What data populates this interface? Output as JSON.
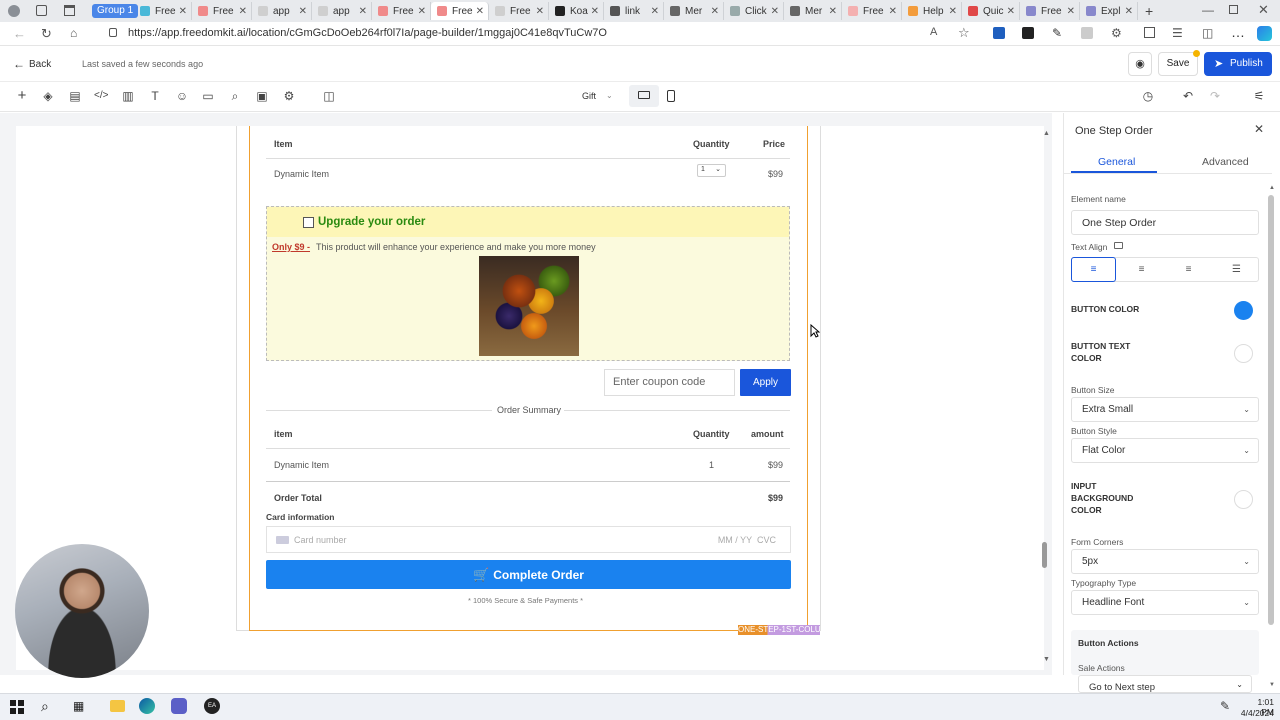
{
  "browser": {
    "group_label": "Group 1",
    "tabs": [
      "Free",
      "Free",
      "app",
      "app",
      "Free",
      "Free",
      "Free",
      "Koa",
      "link",
      "Mer",
      "Click",
      "Mer",
      "Free",
      "Help",
      "Quic",
      "Free",
      "Expl"
    ],
    "url": "https://app.freedomkit.ai/location/cGmGcDoOeb264rf0l7Ia/page-builder/1mggaj0C41e8qvTuCw7O"
  },
  "header": {
    "back_label": "Back",
    "saved_status": "Last saved a few seconds ago",
    "save_label": "Save",
    "publish_label": "Publish"
  },
  "toolbar": {
    "gift_label": "Gift"
  },
  "order": {
    "headers": {
      "item": "Item",
      "quantity": "Quantity",
      "price": "Price"
    },
    "item_name": "Dynamic Item",
    "item_qty": "1",
    "item_price": "$99",
    "upsell": {
      "title": "Upgrade your order",
      "offer_price": "Only $9 -",
      "offer_text": "This product will enhance your experience and make you more money"
    },
    "coupon_placeholder": "Enter coupon code",
    "apply_label": "Apply",
    "summary_title": "Order Summary",
    "summary_headers": {
      "item": "item",
      "quantity": "Quantity",
      "amount": "amount"
    },
    "summary_item": "Dynamic Item",
    "summary_qty": "1",
    "summary_amount": "$99",
    "total_label": "Order Total",
    "total_value": "$99",
    "card_info_label": "Card information",
    "card_placeholder": "Card number",
    "card_exp": "MM / YY  CVC",
    "complete_label": "Complete Order",
    "secure_text": "* 100% Secure & Safe Payments *",
    "column_tag": "ONE-STEP-1ST-COLUMN"
  },
  "panel": {
    "title": "One Step Order",
    "tabs": {
      "general": "General",
      "advanced": "Advanced"
    },
    "element_name_label": "Element name",
    "element_name_value": "One Step Order",
    "text_align_label": "Text Align",
    "button_color_label": "BUTTON COLOR",
    "button_color": "#1a82ef",
    "button_text_color_label": "BUTTON TEXT COLOR",
    "button_text_color": "#ffffff",
    "button_size_label": "Button Size",
    "button_size_value": "Extra Small",
    "button_style_label": "Button Style",
    "button_style_value": "Flat Color",
    "input_bg_label": "INPUT BACKGROUND COLOR",
    "input_bg_color": "#ffffff",
    "form_corners_label": "Form Corners",
    "form_corners_value": "5px",
    "typography_label": "Typography Type",
    "typography_value": "Headline Font",
    "button_actions_label": "Button Actions",
    "sale_actions_label": "Sale Actions",
    "sale_actions_value": "Go to Next step"
  },
  "taskbar": {
    "time": "1:01 PM",
    "date": "4/4/2024"
  },
  "colors": {
    "accent": "#1a56db",
    "column_border": "#f0a030",
    "upsell_green": "#2a8a10",
    "offer_red": "#c0392b"
  }
}
